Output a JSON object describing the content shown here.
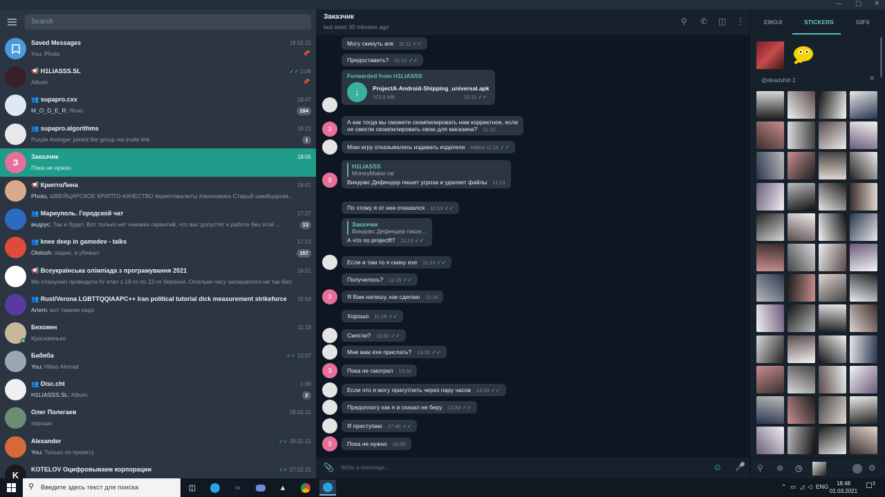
{
  "window": {
    "controls": [
      "—",
      "▢",
      "✕"
    ]
  },
  "left": {
    "search_placeholder": "Search",
    "chats": [
      {
        "name": "Saved Messages",
        "preview": "You: Photo",
        "time": "18.02.21",
        "pinned": true,
        "avatar_color": "#4a9ade",
        "avatar_icon": "bookmark-icon"
      },
      {
        "name": "📢 H1LIASSS.SL",
        "preview": "Album",
        "time": "1:06",
        "pinned": true,
        "read": true,
        "avatar_color": "#3a1f2a"
      },
      {
        "name": "👥 supapro.cxx",
        "preview_sender": "M_O_D_E_R:",
        "preview": " Ясно",
        "time": "18:47",
        "badge": "194",
        "avatar_color": "#dfe9f5"
      },
      {
        "name": "👥 supapro.algorithms",
        "preview": "Purple Avenger joined the group via invite link",
        "time": "18:21",
        "badge": "1",
        "avatar_color": "#e8e8e8"
      },
      {
        "name": "Заказчик",
        "preview": "Пока не нужно",
        "time": "18:05",
        "active": true,
        "avatar_color": "#e86f9a",
        "avatar_letter": "З"
      },
      {
        "name": "📢 КриптоЛина",
        "preview_sender": "Photo,",
        "preview": " ШВЕЙЦАРСКОЕ КРИПТО-КАЧЕСТВО #криптовалюты #экономика    Старый швейцарски...",
        "time": "18:01",
        "avatar_color": "#d8a98a"
      },
      {
        "name": "👥 Мариуполь. Городской чат",
        "preview_sender": "ведрус:",
        "preview": " Так и будет. Вот только нет никаких гарантий, что вас допустят к работе без этой ...",
        "time": "17:37",
        "badge": "13",
        "avatar_color": "#2d6bc1"
      },
      {
        "name": "👥 knee deep in gamedev - talks",
        "preview_sender": "Ololosh:",
        "preview": " ладно, я убежал",
        "time": "17:13",
        "badge": "157",
        "avatar_color": "#e04a3a"
      },
      {
        "name": "📢 Всеукраїнська олімпіада з програмування 2021",
        "preview": "Ми плануємо проводити IV етап з 19-го по 22-ге березня. Оскільки часу залишилося не так бага...",
        "time": "16:01",
        "avatar_color": "#ffffff"
      },
      {
        "name": "👥 Rust/Verona LGBTTQQIAAPC++ Iran political tutorial dick measurement strikeforce",
        "preview_sender": "Artem:",
        "preview": " вот такими надо",
        "time": "15:54",
        "avatar_color": "#5a3aa0"
      },
      {
        "name": "Беховен",
        "preview": "Красивенько",
        "time": "11:18",
        "avatar_color": "#c9b79a",
        "online": true
      },
      {
        "name": "Бабяба",
        "preview_sender": "You:",
        "preview": " Hilias Ahmad",
        "time": "10:37",
        "read": true,
        "avatar_color": "#9aa6b2"
      },
      {
        "name": "👥 Disc.cht",
        "preview_sender": "H1LIASSS.SL:",
        "preview": " Album",
        "time": "1:06",
        "badge": "2",
        "avatar_color": "#f0f0f0"
      },
      {
        "name": "Олег Полегаев",
        "preview": "хорошо",
        "time": "28.02.21",
        "avatar_color": "#6e8b74"
      },
      {
        "name": "Alexander",
        "preview_sender": "You:",
        "preview": " Только по проекту",
        "time": "28.02.21",
        "read": true,
        "avatar_color": "#d86a3a"
      },
      {
        "name": "KOTELOV Оцифровываем корпорации",
        "preview": "",
        "time": "27.02.21",
        "read": true,
        "avatar_color": "#1a1a1a",
        "avatar_letter": "K"
      }
    ]
  },
  "chat": {
    "title": "Заказчик",
    "subtitle": "last seen 30 minutes ago",
    "composer_placeholder": "Write a message...",
    "messages": [
      {
        "text": "Могу скинуть апк",
        "time": "11:11",
        "out": true
      },
      {
        "text": "Предоставить?",
        "time": "11:12",
        "out": true
      },
      {
        "forward": "Forwarded from H1LIASSS",
        "file_name": "ProjectA-Android-Shipping_universal.apk",
        "file_size": "103.9 MB",
        "time": "11:12",
        "out": true
      },
      {
        "text": "А как тогда вы сможете скомпилировать нам корректное, если",
        "text2": "не смогли скомпилировать свою для магазина?",
        "time": "11:12",
        "out": false
      },
      {
        "text": "Мою игру отказывались издавать издатели",
        "time": "edited 11:13",
        "out": true
      },
      {
        "reply_name": "H1LIASSS",
        "reply_text": "MoneyMaker.rar",
        "text": "Виндовс Дефендер пишет угроза и удаляет файлы",
        "time": "11:13",
        "out": false
      },
      {
        "text": "По этому я от нее отказался",
        "time": "11:13",
        "out": true
      },
      {
        "reply_name": "Заказчик",
        "reply_text": "Виндовс Дефендер пише...",
        "text": "А что по projectfl?",
        "time": "11:13",
        "out": true
      },
      {
        "text": "Если и там то я скину exe",
        "time": "11:13",
        "out": true
      },
      {
        "text": "Получилось?",
        "time": "11:15",
        "out": true
      },
      {
        "text": "Я Вам напишу, как сделаю",
        "time": "11:16",
        "out": false
      },
      {
        "text": "Хорошо",
        "time": "11:16",
        "out": true
      },
      {
        "text": "Смогли?",
        "time": "13:32",
        "out": true
      },
      {
        "text": "Мне вам exe прислать?",
        "time": "13:32",
        "out": true
      },
      {
        "text": "Пока не смотрел",
        "time": "13:32",
        "out": false
      },
      {
        "text": "Если что я могу присутпить через пару часов",
        "time": "13:33",
        "out": true
      },
      {
        "text": "Предоплату как я и сказал не беру",
        "time": "13:33",
        "out": true
      },
      {
        "text": "Я приступаю",
        "time": "17:45",
        "out": true
      },
      {
        "text": "Пока не нужно",
        "time": "18:05",
        "out": false
      }
    ]
  },
  "panel": {
    "tabs": [
      "EMOJI",
      "STICKERS",
      "GIFS"
    ],
    "pack_name": "@deadshiit 2"
  },
  "taskbar": {
    "search_placeholder": "Введите здесь текст для поиска",
    "lang": "ENG",
    "time": "18:48",
    "date": "01.03.2021",
    "notif_count": "3"
  }
}
